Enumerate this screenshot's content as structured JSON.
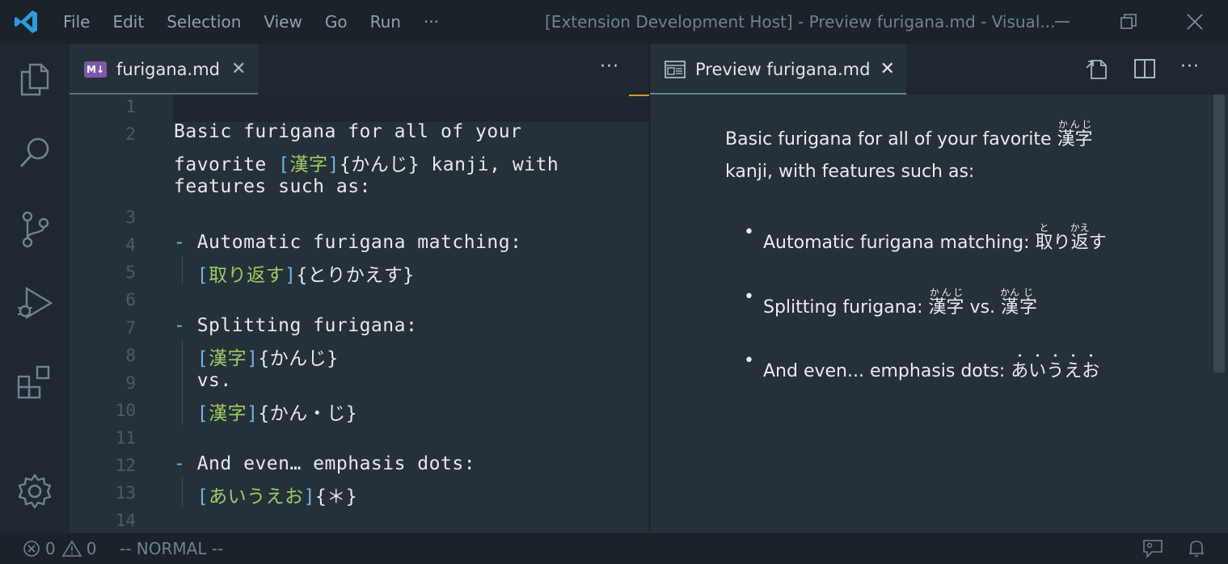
{
  "titlebar": {
    "menu": [
      "File",
      "Edit",
      "Selection",
      "View",
      "Go",
      "Run",
      "···"
    ],
    "window_title": "[Extension Development Host] - Preview furigana.md - Visual..."
  },
  "editor": {
    "tab_label": "furigana.md",
    "tab_badge": "M↓",
    "more": "···",
    "line_numbers": [
      "1",
      "2",
      "",
      "",
      "3",
      "4",
      "5",
      "6",
      "7",
      "8",
      "9",
      "10",
      "11",
      "12",
      "13",
      "14"
    ]
  },
  "preview": {
    "tab_label": "Preview furigana.md",
    "more": "···",
    "para_text_1": "Basic furigana for all of your favorite ",
    "para_kanji": "漢字",
    "para_kanji_ruby": "かんじ",
    "para_text_2": "kanji, with features such as:",
    "item1_text": "Automatic furigana matching: ",
    "item1_k1": "取",
    "item1_k1_ruby": "と",
    "item1_mid": "り",
    "item1_k2": "返",
    "item1_k2_ruby": "かえ",
    "item1_end": "す",
    "item2_text": "Splitting furigana: ",
    "item2_k1": "漢字",
    "item2_k1_ruby": "かんじ",
    "item2_vs": " vs. ",
    "item2_k2a": "漢",
    "item2_k2a_ruby": "かん",
    "item2_k2b": "字",
    "item2_k2b_ruby": "じ",
    "item3_text": "And even... emphasis dots: ",
    "item3_dots": "あいうえお"
  },
  "statusbar": {
    "errors": "0",
    "warnings": "0",
    "mode": "-- NORMAL --"
  },
  "colors": {
    "accent": "#6cb6e8",
    "kanji_green": "#9ccc65",
    "badge": "#7a5aa8"
  }
}
